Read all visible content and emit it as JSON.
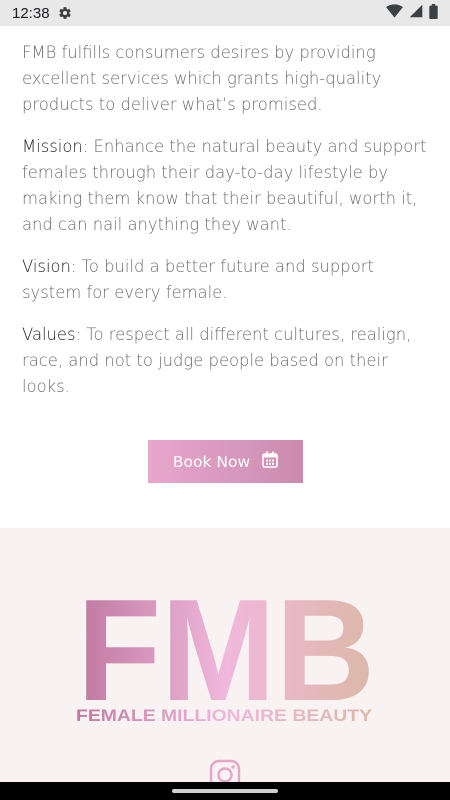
{
  "status_bar": {
    "time": "12:38",
    "icons": [
      "gear-icon",
      "wifi-icon",
      "signal-icon",
      "battery-icon"
    ]
  },
  "about": {
    "intro": "FMB fulfills consumers desires by providing excellent services which grants high-quality products to deliver what’s promised.",
    "mission_label": "Mission",
    "mission_text": ": Enhance the natural beauty and support females through their day-to-day lifestyle by making them know that their beautiful, worth it, and can nail anything they want.",
    "vision_label": "Vision",
    "vision_text": ": To build a better future and support system for every female.",
    "values_label": "Values",
    "values_text": ": To respect all different cultures, realign, race, and not to judge people based on their looks."
  },
  "book_button": {
    "label": "Book Now",
    "icon": "calendar-icon"
  },
  "footer": {
    "logo_letters": "FMB",
    "logo_tagline": "FEMALE MILLIONAIRE BEAUTY",
    "social_icon": "instagram-icon"
  },
  "colors": {
    "accent_pink": "#e8a6cc",
    "accent_mauve": "#c98aae",
    "footer_bg": "#f8f2f3",
    "body_text": "#6d6d6d"
  }
}
